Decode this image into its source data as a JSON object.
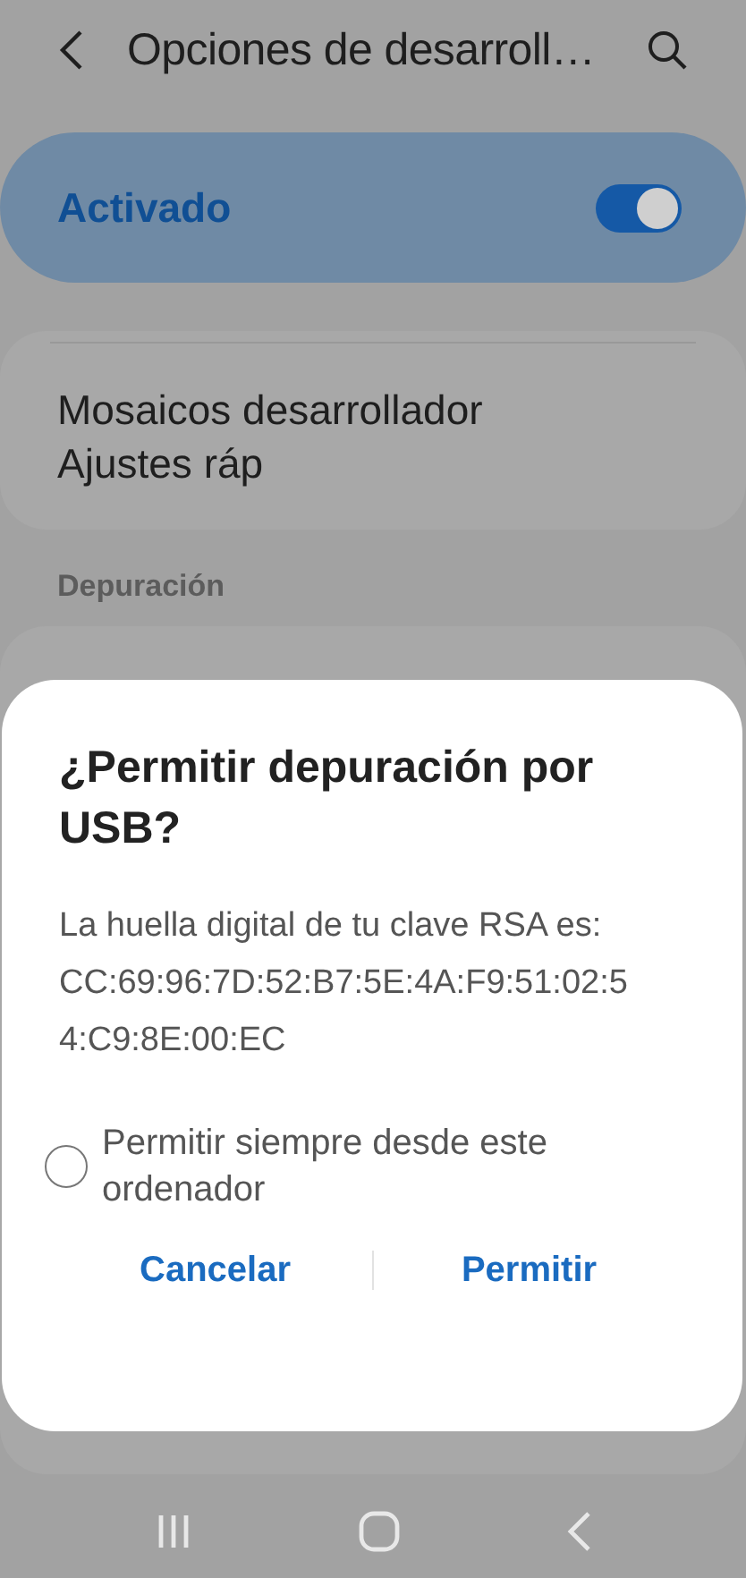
{
  "header": {
    "title": "Opciones de desarroll…"
  },
  "master_switch": {
    "label": "Activado",
    "on": true
  },
  "items": [
    {
      "title": "Mosaicos desarrollador Ajustes ráp"
    }
  ],
  "section": {
    "title": "Depuración"
  },
  "dialog": {
    "title": "¿Permitir depuración por USB?",
    "message": "La huella digital de tu clave RSA es:",
    "fingerprint": "CC:69:96:7D:52:B7:5E:4A:F9:51:02:54:C9:8E:00:EC",
    "checkbox": {
      "label": "Permitir siempre desde este ordenador",
      "checked": false
    },
    "buttons": [
      "Cancelar",
      "Permitir"
    ]
  }
}
